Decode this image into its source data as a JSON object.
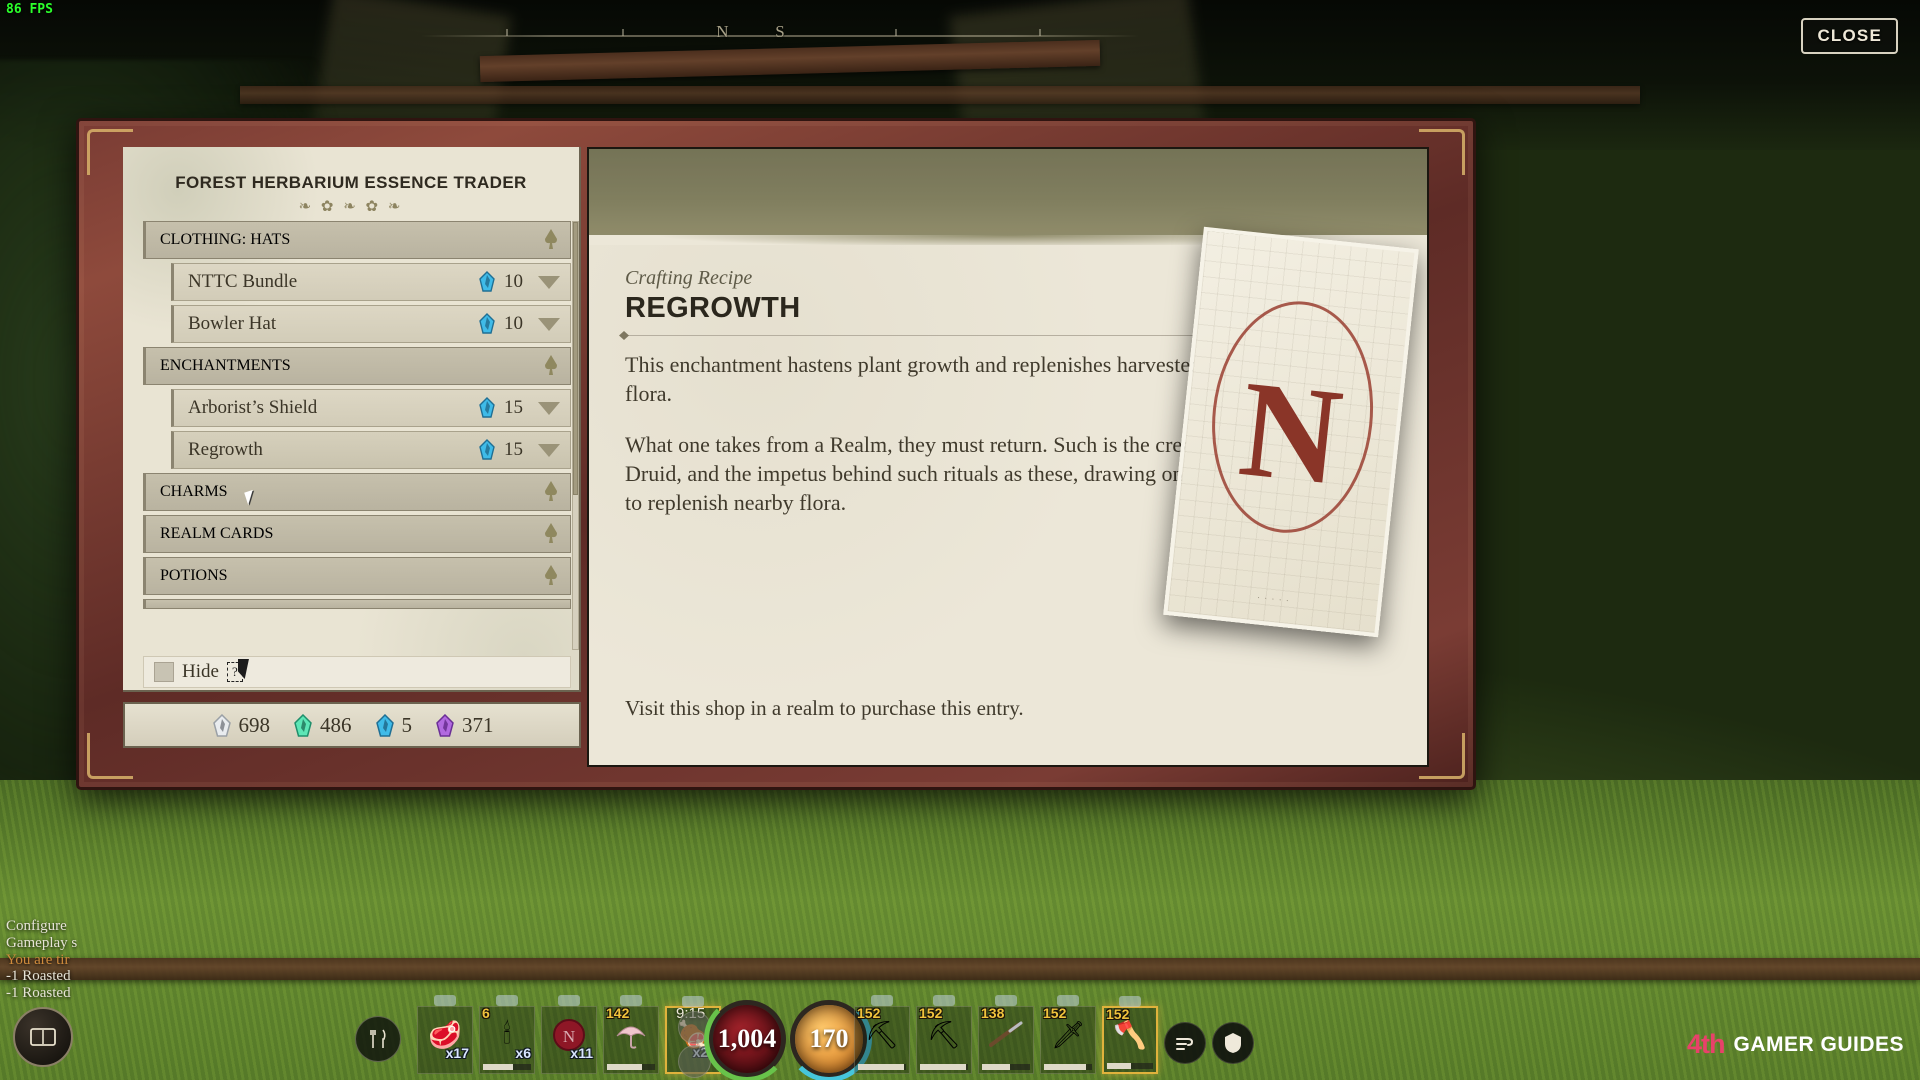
{
  "hud": {
    "fps": "86 FPS",
    "close_label": "CLOSE",
    "clock": "9:15",
    "compass_marks": [
      "N",
      "S"
    ]
  },
  "shop": {
    "title": "FOREST HERBARIUM ESSENCE TRADER",
    "flourish": "❧ ✿ ❧ ✿ ❧",
    "categories": [
      {
        "label": "CLOTHING: HATS",
        "icon": "spade-marker-icon",
        "items": [
          {
            "name": "NTTC Bundle",
            "price": "10",
            "currency_icon": "blue-essence-icon",
            "chevron": "chevron-down-icon"
          },
          {
            "name": "Bowler Hat",
            "price": "10",
            "currency_icon": "blue-essence-icon",
            "chevron": "chevron-down-icon"
          }
        ]
      },
      {
        "label": "ENCHANTMENTS",
        "icon": "spade-marker-icon",
        "items": [
          {
            "name": "Arborist’s Shield",
            "price": "15",
            "currency_icon": "blue-essence-icon",
            "chevron": "chevron-down-icon"
          },
          {
            "name": "Regrowth",
            "price": "15",
            "currency_icon": "blue-essence-icon",
            "chevron": "chevron-down-icon",
            "selected": true
          }
        ]
      },
      {
        "label": "CHARMS",
        "icon": "spade-marker-icon",
        "items": []
      },
      {
        "label": "REALM CARDS",
        "icon": "spade-marker-icon",
        "items": []
      },
      {
        "label": "POTIONS",
        "icon": "spade-marker-icon",
        "items": []
      }
    ],
    "hide_label": "Hide",
    "hide_checked": false,
    "missing_glyph": "?"
  },
  "currency": [
    {
      "name": "white-essence",
      "amount": "698",
      "color": "#e9ecef"
    },
    {
      "name": "green-essence",
      "amount": "486",
      "color": "#5de6b6"
    },
    {
      "name": "blue-essence",
      "amount": "5",
      "color": "#3fbbe8"
    },
    {
      "name": "purple-essence",
      "amount": "371",
      "color": "#b26ae0"
    }
  ],
  "detail": {
    "kicker": "Crafting Recipe",
    "title": "REGROWTH",
    "paragraphs": [
      "This enchantment hastens plant growth and replenishes harvested trees and flora.",
      "What one takes from a Realm, they must return. Such is the creed of many a Druid, and the impetus behind such rituals as these, drawing one’s own magick to replenish nearby flora."
    ],
    "purchase_note": "Visit this shop in a realm to purchase this entry.",
    "journal_card": {
      "monogram": "N",
      "caption": "· · · · ·"
    }
  },
  "hotbar": {
    "food_icon": "fork-knife-icon",
    "slots": [
      {
        "icon": "meat-raw-icon",
        "qty": "x17",
        "durability_label": "",
        "bar": 0,
        "selected": false
      },
      {
        "icon": "torch-icon",
        "qty": "x6",
        "durability_label": "6",
        "bar": 62,
        "selected": false
      },
      {
        "icon": "wax-seal-icon",
        "qty": "x11",
        "durability_label": "",
        "bar": 0,
        "selected": false
      },
      {
        "icon": "umbrella-icon",
        "qty": "",
        "durability_label": "142",
        "bar": 72,
        "selected": false
      },
      {
        "icon": "cooked-steak-icon",
        "qty": "x22",
        "durability_label": "",
        "bar": 0,
        "selected": true
      },
      {
        "icon": "pickaxe-icon",
        "qty": "",
        "durability_label": "152",
        "bar": 96,
        "selected": false
      },
      {
        "icon": "ornate-pickaxe-icon",
        "qty": "",
        "durability_label": "152",
        "bar": 96,
        "selected": false
      },
      {
        "icon": "musket-icon",
        "qty": "",
        "durability_label": "138",
        "bar": 58,
        "selected": false
      },
      {
        "icon": "flintlock-dagger-icon",
        "qty": "",
        "durability_label": "152",
        "bar": 88,
        "selected": false
      },
      {
        "icon": "battle-axe-icon",
        "qty": "",
        "durability_label": "152",
        "bar": 52,
        "selected": true
      }
    ],
    "health": "1,004",
    "stamina": "170",
    "tool_icons": [
      "wind-swirl-icon",
      "shield-icon"
    ]
  },
  "debug_log": [
    {
      "text": "Configure",
      "tone": "white"
    },
    {
      "text": "Gameplay s",
      "tone": "white"
    },
    {
      "text": "You are tir",
      "tone": "orange"
    },
    {
      "text": "-1 Roasted",
      "tone": "white"
    },
    {
      "text": "-1 Roasted",
      "tone": "white"
    }
  ],
  "journal_button_icon": "book-icon",
  "watermark": {
    "mark": "4th",
    "text": "GAMER GUIDES"
  }
}
